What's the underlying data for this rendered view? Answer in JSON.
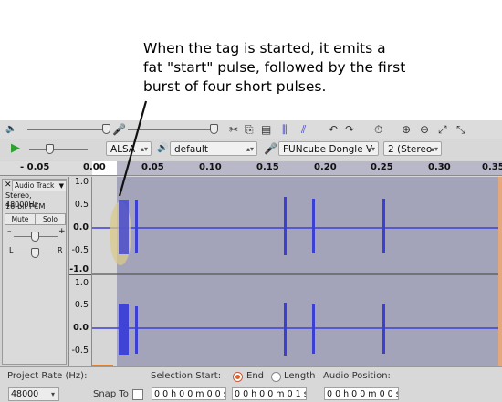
{
  "annotation": {
    "lines": [
      "When the tag is started, it emits a",
      "fat \"start\" pulse, followed by the first",
      "burst of four short pulses."
    ]
  },
  "device_toolbar": {
    "host": "ALSA",
    "playback_device": "default",
    "recording_device": "FUNcube Dongle V",
    "channels": "2 (Stereo"
  },
  "ruler": {
    "labels": [
      "- 0.05",
      "0.00",
      "0.05",
      "0.10",
      "0.15",
      "0.20",
      "0.25",
      "0.30",
      "0.35"
    ]
  },
  "track": {
    "name": "Audio Track",
    "format": "Stereo, 48000Hz",
    "bits": "16-bit PCM",
    "mute_label": "Mute",
    "solo_label": "Solo",
    "pan_left": "L",
    "pan_right": "R",
    "ch1_scale": [
      "1.0",
      "0.5",
      "0.0",
      "-0.5",
      "-1.0"
    ],
    "ch2_scale": [
      "1.0",
      "0.5",
      "0.0",
      "-0.5"
    ]
  },
  "status": {
    "project_rate_label": "Project Rate (Hz):",
    "project_rate_value": "48000",
    "snap_to_label": "Snap To",
    "selection_start_label": "Selection Start:",
    "end_label": "End",
    "length_label": "Length",
    "audio_position_label": "Audio Position:",
    "sel_start": "0 0 h 0 0 m 0 0 s",
    "sel_end": "0 0 h 0 0 m 0 1 s",
    "audio_pos": "0 0 h 0 0 m 0 0 s"
  },
  "colors": {
    "waveform": "#3c3fd4",
    "track_bg": "#a3a4b9",
    "selection": "#d6d6d6",
    "highlight_ellipse": "#d9c98a",
    "play_green": "#2da12d"
  }
}
